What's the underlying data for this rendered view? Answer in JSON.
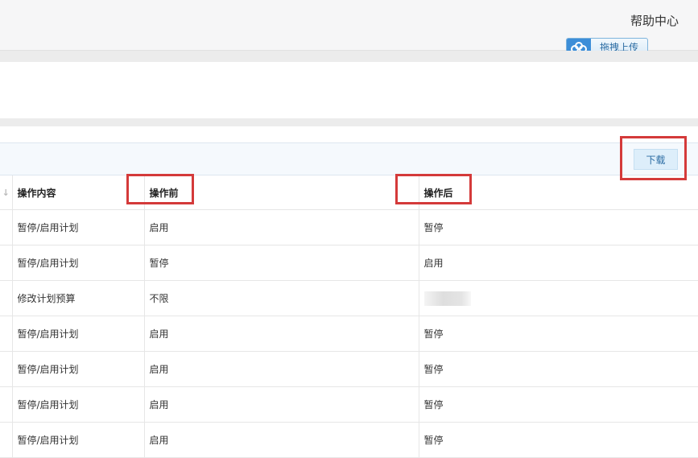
{
  "header": {
    "help_label": "帮助中心",
    "upload_label": "拖拽上传"
  },
  "toolbar": {
    "download_label": "下载"
  },
  "table": {
    "columns": [
      "操作内容",
      "操作前",
      "操作后"
    ],
    "rows": [
      [
        "暂停/启用计划",
        "启用",
        "暂停"
      ],
      [
        "暂停/启用计划",
        "暂停",
        "启用"
      ],
      [
        "修改计划预算",
        "不限",
        ""
      ],
      [
        "暂停/启用计划",
        "启用",
        "暂停"
      ],
      [
        "暂停/启用计划",
        "启用",
        "暂停"
      ],
      [
        "暂停/启用计划",
        "启用",
        "暂停"
      ],
      [
        "暂停/启用计划",
        "启用",
        "暂停"
      ]
    ]
  },
  "colors": {
    "highlight_box": "#d43a3a",
    "accent": "#3d8ed8"
  }
}
